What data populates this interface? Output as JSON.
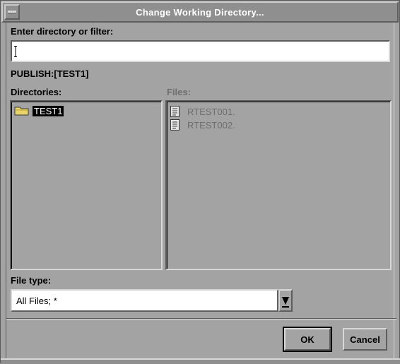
{
  "window": {
    "title": "Change Working Directory..."
  },
  "filter": {
    "label": "Enter directory or filter:",
    "value": ""
  },
  "current_path": "PUBLISH:[TEST1]",
  "directories": {
    "label": "Directories:",
    "items": [
      {
        "name": "TEST1",
        "icon": "folder-icon",
        "selected": true
      }
    ]
  },
  "files": {
    "label": "Files:",
    "items": [
      {
        "name": "RTEST001.",
        "icon": "document-icon"
      },
      {
        "name": "RTEST002.",
        "icon": "document-icon"
      }
    ]
  },
  "file_type": {
    "label": "File type:",
    "selected": "All Files; *"
  },
  "buttons": {
    "ok": "OK",
    "cancel": "Cancel"
  },
  "colors": {
    "background": "#a3a3a3",
    "titlebar": "#8f8f8f",
    "selection": "#000000",
    "disabled_text": "#6e6e6e",
    "folder": "#e8d46a"
  }
}
